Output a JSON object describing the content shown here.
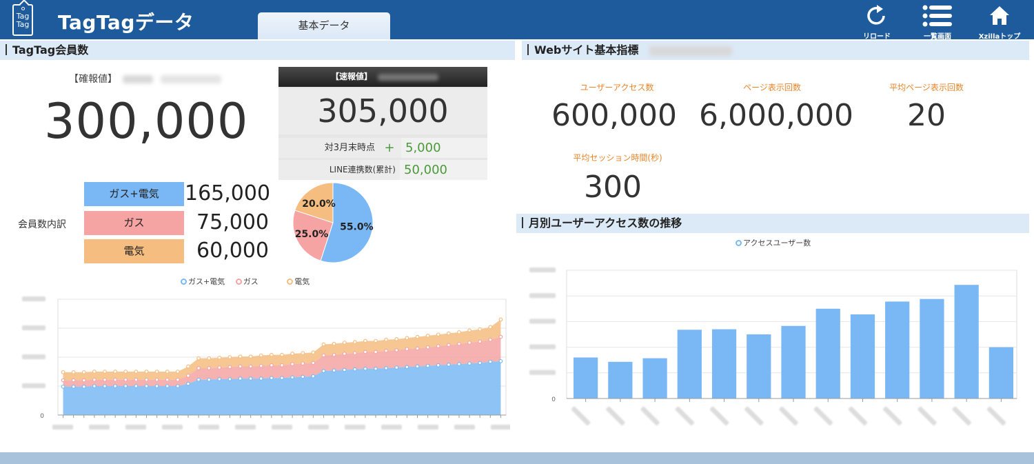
{
  "header": {
    "app_title": "TagTagデータ",
    "logo_text": [
      "Tag",
      "Tag"
    ],
    "tab_label": "基本データ",
    "buttons": [
      {
        "label": "リロード",
        "icon": "reload-icon"
      },
      {
        "label": "一覧画面",
        "icon": "list-icon"
      },
      {
        "label": "Xzillaトップ",
        "icon": "home-icon"
      }
    ],
    "color": "#1e5b9c"
  },
  "members": {
    "section_title": "TagTag会員数",
    "confirmed_label": "【確報値】",
    "confirmed_value": "300,000",
    "preliminary_label": "【速報値】",
    "preliminary_value": "305,000",
    "vs_march_label": "対3月末時点",
    "vs_march_sign": "+",
    "vs_march_value": "5,000",
    "line_label": "LINE連携数(累計)",
    "line_value": "50,000",
    "breakdown_label": "会員数内訳",
    "breakdown": [
      {
        "name": "ガス+電気",
        "value": "165,000",
        "color": "#7ab8f5"
      },
      {
        "name": "ガス",
        "value": "75,000",
        "color": "#f5a3a3"
      },
      {
        "name": "電気",
        "value": "60,000",
        "color": "#f6bd80"
      }
    ]
  },
  "web": {
    "section_title": "Webサイト基本指標",
    "metrics": [
      {
        "label": "ユーザーアクセス数",
        "value": "600,000"
      },
      {
        "label": "ページ表示回数",
        "value": "6,000,000"
      },
      {
        "label": "平均ページ表示回数",
        "value": "20"
      },
      {
        "label": "平均セッション時間(秒)",
        "value": "300"
      }
    ],
    "monthly_title": "月別ユーザーアクセス数の推移"
  },
  "chart_data": [
    {
      "type": "pie",
      "labels": [
        "ガス+電気",
        "ガス",
        "電気"
      ],
      "values": [
        55.0,
        25.0,
        20.0
      ],
      "value_labels": [
        "55.0%",
        "25.0%",
        "20.0%"
      ],
      "colors": [
        "#7ab8f5",
        "#f5a3a3",
        "#f6bd80"
      ]
    },
    {
      "type": "area",
      "stacked": true,
      "legend": [
        "ガス+電気",
        "ガス",
        "電気"
      ],
      "legend_position": "top",
      "y_tick_labels": [
        "0"
      ],
      "ylim": [
        0,
        200000
      ],
      "grid": true,
      "series": [
        {
          "name": "ガス+電気",
          "color": "#7ab8f5",
          "values": [
            49000,
            49000,
            49000,
            50000,
            50000,
            50000,
            50000,
            50000,
            50000,
            50000,
            50000,
            50000,
            54000,
            61000,
            61000,
            62000,
            62000,
            63000,
            63000,
            63000,
            64000,
            64000,
            65000,
            66000,
            67000,
            76000,
            77000,
            78000,
            79000,
            80000,
            80000,
            81000,
            82000,
            83000,
            84000,
            85000,
            86000,
            87000,
            88000,
            89000,
            90000,
            92000,
            93000
          ]
        },
        {
          "name": "ガス",
          "color": "#f5a3a3",
          "values": [
            11000,
            11000,
            11000,
            11000,
            11000,
            11000,
            11000,
            11000,
            11000,
            11000,
            11000,
            11000,
            14000,
            20000,
            20000,
            20000,
            21000,
            21000,
            21000,
            22000,
            22000,
            22000,
            23000,
            23000,
            23000,
            27000,
            27000,
            28000,
            28000,
            29000,
            29000,
            30000,
            30000,
            31000,
            31000,
            32000,
            33000,
            34000,
            35000,
            36000,
            37000,
            38000,
            42000
          ]
        },
        {
          "name": "電気",
          "color": "#f6bd80",
          "values": [
            14000,
            14000,
            14000,
            14000,
            14000,
            14000,
            14000,
            14000,
            14000,
            14000,
            14000,
            14000,
            16000,
            17000,
            17000,
            17000,
            17000,
            17000,
            17000,
            18000,
            18000,
            18000,
            18000,
            18000,
            18000,
            19000,
            19000,
            19000,
            19000,
            19000,
            19000,
            19000,
            19000,
            19000,
            20000,
            20000,
            20000,
            20000,
            20000,
            21000,
            21000,
            22000,
            30000
          ]
        }
      ]
    },
    {
      "type": "bar",
      "legend": [
        "アクセスユーザー数"
      ],
      "legend_position": "top",
      "y_tick_labels": [
        "0"
      ],
      "ylim": [
        0,
        500000
      ],
      "grid": true,
      "color": "#7ab8f5",
      "series": [
        {
          "name": "アクセスユーザー数",
          "values": [
            160000,
            143000,
            157000,
            268000,
            270000,
            250000,
            283000,
            350000,
            328000,
            378000,
            388000,
            443000,
            200000
          ]
        }
      ]
    }
  ]
}
